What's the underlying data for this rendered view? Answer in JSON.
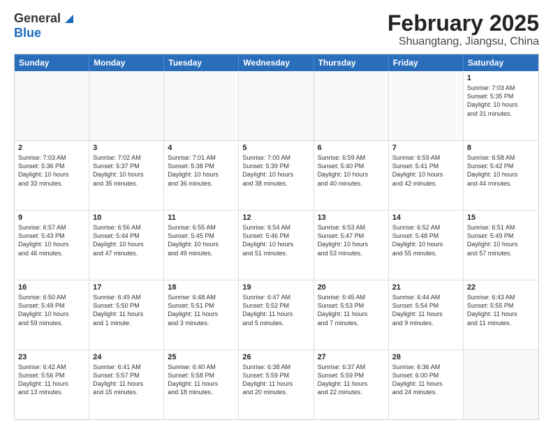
{
  "logo": {
    "general": "General",
    "blue": "Blue"
  },
  "header": {
    "month": "February 2025",
    "location": "Shuangtang, Jiangsu, China"
  },
  "weekdays": [
    "Sunday",
    "Monday",
    "Tuesday",
    "Wednesday",
    "Thursday",
    "Friday",
    "Saturday"
  ],
  "weeks": [
    [
      {
        "day": "",
        "info": ""
      },
      {
        "day": "",
        "info": ""
      },
      {
        "day": "",
        "info": ""
      },
      {
        "day": "",
        "info": ""
      },
      {
        "day": "",
        "info": ""
      },
      {
        "day": "",
        "info": ""
      },
      {
        "day": "1",
        "info": "Sunrise: 7:03 AM\nSunset: 5:35 PM\nDaylight: 10 hours\nand 31 minutes."
      }
    ],
    [
      {
        "day": "2",
        "info": "Sunrise: 7:03 AM\nSunset: 5:36 PM\nDaylight: 10 hours\nand 33 minutes."
      },
      {
        "day": "3",
        "info": "Sunrise: 7:02 AM\nSunset: 5:37 PM\nDaylight: 10 hours\nand 35 minutes."
      },
      {
        "day": "4",
        "info": "Sunrise: 7:01 AM\nSunset: 5:38 PM\nDaylight: 10 hours\nand 36 minutes."
      },
      {
        "day": "5",
        "info": "Sunrise: 7:00 AM\nSunset: 5:39 PM\nDaylight: 10 hours\nand 38 minutes."
      },
      {
        "day": "6",
        "info": "Sunrise: 6:59 AM\nSunset: 5:40 PM\nDaylight: 10 hours\nand 40 minutes."
      },
      {
        "day": "7",
        "info": "Sunrise: 6:59 AM\nSunset: 5:41 PM\nDaylight: 10 hours\nand 42 minutes."
      },
      {
        "day": "8",
        "info": "Sunrise: 6:58 AM\nSunset: 5:42 PM\nDaylight: 10 hours\nand 44 minutes."
      }
    ],
    [
      {
        "day": "9",
        "info": "Sunrise: 6:57 AM\nSunset: 5:43 PM\nDaylight: 10 hours\nand 46 minutes."
      },
      {
        "day": "10",
        "info": "Sunrise: 6:56 AM\nSunset: 5:44 PM\nDaylight: 10 hours\nand 47 minutes."
      },
      {
        "day": "11",
        "info": "Sunrise: 6:55 AM\nSunset: 5:45 PM\nDaylight: 10 hours\nand 49 minutes."
      },
      {
        "day": "12",
        "info": "Sunrise: 6:54 AM\nSunset: 5:46 PM\nDaylight: 10 hours\nand 51 minutes."
      },
      {
        "day": "13",
        "info": "Sunrise: 6:53 AM\nSunset: 5:47 PM\nDaylight: 10 hours\nand 53 minutes."
      },
      {
        "day": "14",
        "info": "Sunrise: 6:52 AM\nSunset: 5:48 PM\nDaylight: 10 hours\nand 55 minutes."
      },
      {
        "day": "15",
        "info": "Sunrise: 6:51 AM\nSunset: 5:49 PM\nDaylight: 10 hours\nand 57 minutes."
      }
    ],
    [
      {
        "day": "16",
        "info": "Sunrise: 6:50 AM\nSunset: 5:49 PM\nDaylight: 10 hours\nand 59 minutes."
      },
      {
        "day": "17",
        "info": "Sunrise: 6:49 AM\nSunset: 5:50 PM\nDaylight: 11 hours\nand 1 minute."
      },
      {
        "day": "18",
        "info": "Sunrise: 6:48 AM\nSunset: 5:51 PM\nDaylight: 11 hours\nand 3 minutes."
      },
      {
        "day": "19",
        "info": "Sunrise: 6:47 AM\nSunset: 5:52 PM\nDaylight: 11 hours\nand 5 minutes."
      },
      {
        "day": "20",
        "info": "Sunrise: 6:45 AM\nSunset: 5:53 PM\nDaylight: 11 hours\nand 7 minutes."
      },
      {
        "day": "21",
        "info": "Sunrise: 6:44 AM\nSunset: 5:54 PM\nDaylight: 11 hours\nand 9 minutes."
      },
      {
        "day": "22",
        "info": "Sunrise: 6:43 AM\nSunset: 5:55 PM\nDaylight: 11 hours\nand 11 minutes."
      }
    ],
    [
      {
        "day": "23",
        "info": "Sunrise: 6:42 AM\nSunset: 5:56 PM\nDaylight: 11 hours\nand 13 minutes."
      },
      {
        "day": "24",
        "info": "Sunrise: 6:41 AM\nSunset: 5:57 PM\nDaylight: 11 hours\nand 15 minutes."
      },
      {
        "day": "25",
        "info": "Sunrise: 6:40 AM\nSunset: 5:58 PM\nDaylight: 11 hours\nand 18 minutes."
      },
      {
        "day": "26",
        "info": "Sunrise: 6:38 AM\nSunset: 5:59 PM\nDaylight: 11 hours\nand 20 minutes."
      },
      {
        "day": "27",
        "info": "Sunrise: 6:37 AM\nSunset: 5:59 PM\nDaylight: 11 hours\nand 22 minutes."
      },
      {
        "day": "28",
        "info": "Sunrise: 6:36 AM\nSunset: 6:00 PM\nDaylight: 11 hours\nand 24 minutes."
      },
      {
        "day": "",
        "info": ""
      }
    ]
  ]
}
